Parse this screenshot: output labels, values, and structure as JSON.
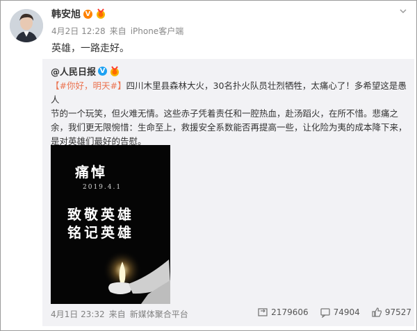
{
  "post": {
    "author": "韩安旭",
    "time": "4月2日 12:28",
    "source_prefix": "来自",
    "source": "iPhone客户端",
    "text": "英雄，一路走好。"
  },
  "repost": {
    "author": "@人民日报",
    "topic": "#你好，明天#",
    "text_line1_rest": "四川木里县森林大火，30名扑火队员壮烈牺牲，太痛心了！多希望这是愚人",
    "text_line2": "节的一个玩笑，但火难无情。这些赤子凭着责任和一腔热血，赴汤蹈火，在所不惜。悲痛之",
    "text_line3": "余，我们更无限惋惜：生命至上，救援安全系数能否再提高一些，让化险为夷的成本降下来，",
    "text_line4": "是对英雄们最好的告慰。",
    "poster": {
      "title": "痛悼",
      "date": "2019.4.1",
      "line1": "致敬英雄",
      "line2": "铭记英雄"
    },
    "time": "4月1日 23:32",
    "source_prefix": "来自",
    "source": "新媒体聚合平台",
    "reposts": "2179606",
    "comments": "74904",
    "likes": "97527"
  },
  "colors": {
    "accent_orange": "#ff8200",
    "verified_blue": "#1da1f2",
    "topic_link": "#eb7350",
    "repost_bg": "#f2f2f5"
  },
  "icons": [
    "avatar",
    "verified-icon",
    "medal-icon",
    "chevron-down-icon",
    "repost-icon",
    "comment-icon",
    "like-icon"
  ]
}
